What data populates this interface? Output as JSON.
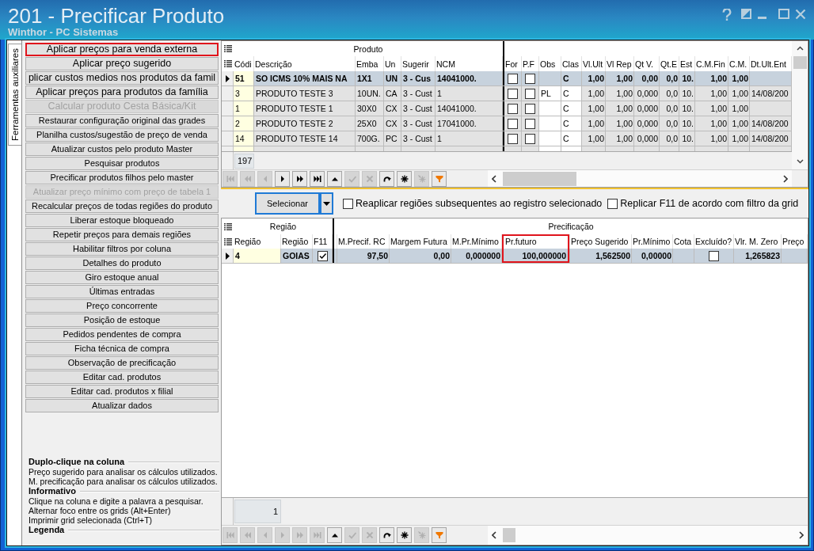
{
  "window": {
    "title": "201 - Precificar Produto",
    "subtitle": "Winthor - PC Sistemas"
  },
  "side_panel": {
    "tabs": [
      {
        "label": "Ferramentas auxiliares",
        "selected": true
      }
    ],
    "main_actions": [
      {
        "label": "Aplicar preços para venda externa",
        "disabled": false,
        "highlighted": true
      },
      {
        "label": "Aplicar preço sugerido",
        "disabled": false,
        "highlighted": false
      },
      {
        "label": "plicar custos medios nos produtos da famil",
        "disabled": false,
        "highlighted": false
      },
      {
        "label": "Aplicar preços para produtos da família",
        "disabled": false,
        "highlighted": false
      },
      {
        "label": "Calcular produto Cesta Básica/Kit",
        "disabled": true,
        "highlighted": false
      }
    ],
    "tools": [
      {
        "label": "Restaurar configuração original das grades",
        "disabled": false,
        "highlighted": false
      },
      {
        "label": "Planilha custos/sugestão de preço de venda",
        "disabled": false,
        "highlighted": false
      },
      {
        "label": "Atualizar custos pelo produto Master",
        "disabled": false,
        "highlighted": false
      },
      {
        "label": "Pesquisar produtos",
        "disabled": false,
        "highlighted": false
      },
      {
        "label": "Precificar produtos filhos pelo master",
        "disabled": false,
        "highlighted": false
      },
      {
        "label": "Atualizar preço mínimo com preço de tabela 1",
        "disabled": true,
        "highlighted": false
      },
      {
        "label": "Recalcular preços de todas regiões do produto",
        "disabled": false,
        "highlighted": false
      },
      {
        "label": "Liberar estoque bloqueado",
        "disabled": false,
        "highlighted": false
      },
      {
        "label": "Repetir preços para demais regiões",
        "disabled": false,
        "highlighted": false
      },
      {
        "label": "Habilitar filtros por coluna",
        "disabled": false,
        "highlighted": false
      },
      {
        "label": "Detalhes do produto",
        "disabled": false,
        "highlighted": false
      },
      {
        "label": "Giro estoque anual",
        "disabled": false,
        "highlighted": false
      },
      {
        "label": "Últimas entradas",
        "disabled": false,
        "highlighted": false
      },
      {
        "label": "Preço concorrente",
        "disabled": false,
        "highlighted": false
      },
      {
        "label": "Posição de estoque",
        "disabled": false,
        "highlighted": false
      },
      {
        "label": "Pedidos pendentes de compra",
        "disabled": false,
        "highlighted": false
      },
      {
        "label": "Ficha técnica de compra",
        "disabled": false,
        "highlighted": false
      },
      {
        "label": "Observação de precificação",
        "disabled": false,
        "highlighted": false
      },
      {
        "label": "Editar cad. produtos",
        "disabled": false,
        "highlighted": false
      },
      {
        "label": "Editar cad. produtos x filial",
        "disabled": false,
        "highlighted": false
      },
      {
        "label": "Atualizar dados",
        "disabled": false,
        "highlighted": false
      }
    ],
    "help": [
      {
        "heading": "Duplo-clique na coluna",
        "lines": [
          "Preço sugerido para analisar os cálculos utilizados.",
          "M. precificação para analisar os cálculos utilizados."
        ]
      },
      {
        "heading": "Informativo",
        "lines": [
          "Clique na coluna e digite a palavra a pesquisar.",
          "Alternar foco entre os grids (Alt+Enter)",
          "Imprimir grid selecionada (Ctrl+T)"
        ]
      },
      {
        "heading": "Legenda"
      }
    ]
  },
  "product_grid": {
    "bands": [
      "Produto"
    ],
    "columns": [
      {
        "label": "Códi",
        "kind": "key"
      },
      {
        "label": "Descrição",
        "kind": "text"
      },
      {
        "label": "Emba",
        "kind": "text"
      },
      {
        "label": "Un",
        "kind": "text"
      },
      {
        "label": "Sugerir",
        "kind": "text"
      },
      {
        "label": "NCM",
        "kind": "text"
      },
      {
        "label": "For",
        "kind": "check"
      },
      {
        "label": "P.F",
        "kind": "check"
      },
      {
        "label": "Obs",
        "kind": "edit"
      },
      {
        "label": "Clas",
        "kind": "edit"
      },
      {
        "label": "Vl.Ult",
        "kind": "number"
      },
      {
        "label": "Vl Rep",
        "kind": "number"
      },
      {
        "label": "Qt V.",
        "kind": "number"
      },
      {
        "label": "Qt.E",
        "kind": "number"
      },
      {
        "label": "Est",
        "kind": "number"
      },
      {
        "label": "C.M.Fin",
        "kind": "number"
      },
      {
        "label": "C.M.",
        "kind": "number"
      },
      {
        "label": "Dt.Ult.Ent",
        "kind": "text"
      }
    ],
    "rows": [
      {
        "selected": true,
        "cells": [
          "51",
          "SO ICMS 10% MAIS NA",
          "1X1",
          "UN",
          "3 - Cus",
          "14041000.",
          {
            "checked": false
          },
          {
            "checked": false
          },
          null,
          "C",
          "1,00",
          "1,00",
          "0,00",
          "0,0",
          "10.",
          "1,00",
          "1,00",
          null
        ]
      },
      {
        "selected": false,
        "cells": [
          "3",
          "PRODUTO TESTE 3",
          "10UN.",
          "CA",
          "3 - Cust",
          "1",
          {
            "checked": false
          },
          {
            "checked": false
          },
          "PL",
          "C",
          "1,00",
          "1,00",
          "0,000",
          "0,0",
          "10.",
          "1,00",
          "1,00",
          "14/08/200"
        ]
      },
      {
        "selected": false,
        "cells": [
          "1",
          "PRODUTO TESTE 1",
          "30X0",
          "CX",
          "3 - Cust",
          "14041000.",
          {
            "checked": false
          },
          {
            "checked": false
          },
          null,
          "C",
          "1,00",
          "1,00",
          "0,000",
          "0,0",
          "10.",
          "1,00",
          "1,00",
          null
        ]
      },
      {
        "selected": false,
        "cells": [
          "2",
          "PRODUTO TESTE 2",
          "25X0",
          "CX",
          "3 - Cust",
          "17041000.",
          {
            "checked": false
          },
          {
            "checked": false
          },
          null,
          "C",
          "1,00",
          "1,00",
          "0,000",
          "0,0",
          "10.",
          "1,00",
          "1,00",
          "14/08/200"
        ]
      },
      {
        "selected": false,
        "cells": [
          "14",
          "PRODUTO TESTE 14",
          "700G.",
          "PC",
          "3 - Cust",
          "1",
          {
            "checked": false
          },
          {
            "checked": false
          },
          null,
          "C",
          "1,00",
          "1,00",
          "0,000",
          "0,0",
          "10.",
          "1,00",
          "1,00",
          "14/08/200"
        ]
      }
    ],
    "count": "197",
    "navigator": [
      {
        "kind": "first",
        "disabled": true
      },
      {
        "kind": "rewind",
        "disabled": true
      },
      {
        "kind": "prior",
        "disabled": true
      },
      {
        "kind": "next",
        "disabled": false
      },
      {
        "kind": "forward",
        "disabled": false
      },
      {
        "kind": "last",
        "disabled": false
      },
      {
        "kind": "edit",
        "disabled": false
      },
      {
        "kind": "post",
        "disabled": true
      },
      {
        "kind": "cancel",
        "disabled": true
      },
      {
        "kind": "refresh",
        "disabled": false
      },
      {
        "kind": "bookmark",
        "disabled": false
      },
      {
        "kind": "gotobookmark",
        "disabled": true
      },
      {
        "kind": "filter",
        "disabled": false
      }
    ]
  },
  "selection_bar": {
    "button": {
      "label": "Selecionar",
      "focused": true
    },
    "options": [
      {
        "label": "Reaplicar regiões subsequentes ao registro selecionado",
        "checked": false
      },
      {
        "label": "Replicar F11 de acordo com filtro da grid",
        "checked": false
      }
    ]
  },
  "region_grid": {
    "bands": [
      "Região",
      "Precificação"
    ],
    "columns": [
      {
        "label": "Região",
        "kind": "key",
        "highlighted": false
      },
      {
        "label": "Região",
        "kind": "text",
        "highlighted": false
      },
      {
        "label": "F11",
        "kind": "check",
        "highlighted": false
      },
      {
        "label": "M.Precif. RC",
        "kind": "number",
        "highlighted": false
      },
      {
        "label": "Margem Futura",
        "kind": "number",
        "highlighted": false
      },
      {
        "label": "M.Pr.Mínimo",
        "kind": "number",
        "highlighted": false
      },
      {
        "label": "Pr.futuro",
        "kind": "number",
        "highlighted": true
      },
      {
        "label": "Preço Sugerido",
        "kind": "number",
        "highlighted": false
      },
      {
        "label": "Pr.Mínimo",
        "kind": "number",
        "highlighted": false
      },
      {
        "label": "Cota",
        "kind": "text",
        "highlighted": false
      },
      {
        "label": "Excluído?",
        "kind": "check",
        "highlighted": false
      },
      {
        "label": "Vlr. M. Zero",
        "kind": "number",
        "highlighted": false
      },
      {
        "label": "Preço",
        "kind": "text",
        "highlighted": false
      }
    ],
    "rows": [
      {
        "selected": true,
        "cells": [
          "4",
          "GOIAS",
          {
            "checked": true
          },
          "97,50",
          "0,00",
          "0,000000",
          "100,000000",
          "1,562500",
          "0,00000",
          null,
          {
            "checked": false
          },
          "1,265823",
          null
        ]
      }
    ],
    "count": "1",
    "navigator": [
      {
        "kind": "first",
        "disabled": true
      },
      {
        "kind": "rewind",
        "disabled": true
      },
      {
        "kind": "prior",
        "disabled": true
      },
      {
        "kind": "next",
        "disabled": true
      },
      {
        "kind": "forward",
        "disabled": true
      },
      {
        "kind": "last",
        "disabled": true
      },
      {
        "kind": "edit",
        "disabled": false
      },
      {
        "kind": "post",
        "disabled": true
      },
      {
        "kind": "cancel",
        "disabled": true
      },
      {
        "kind": "refresh",
        "disabled": false
      },
      {
        "kind": "bookmark",
        "disabled": false
      },
      {
        "kind": "gotobookmark",
        "disabled": true
      },
      {
        "kind": "filter",
        "disabled": false
      }
    ]
  }
}
